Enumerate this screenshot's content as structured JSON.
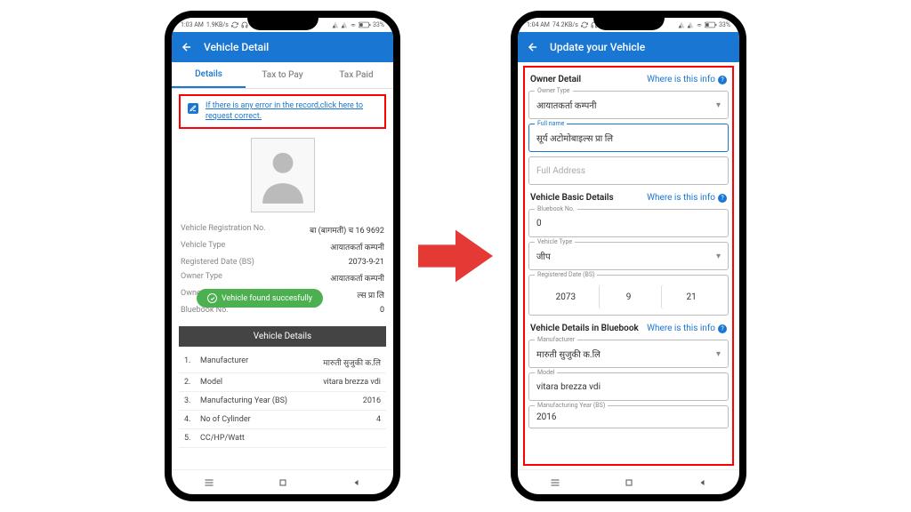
{
  "left": {
    "status": {
      "time": "1:03 AM",
      "speed": "1.9KB/s",
      "battery": "33%"
    },
    "title": "Vehicle Detail",
    "tabs": [
      "Details",
      "Tax to Pay",
      "Tax Paid"
    ],
    "error_link": "If there is any error in the record,click here to request correct.",
    "info": {
      "reg_no_label": "Vehicle Registration No.",
      "reg_no": "बा (बागमती) च 16 9692",
      "veh_type_label": "Vehicle Type",
      "veh_type": "आयातकर्ता कम्पनी",
      "reg_date_label": "Registered Date (BS)",
      "reg_date": "2073-9-21",
      "owner_type_label": "Owner Type",
      "owner_type": "आयातकर्ता कम्पनी",
      "owner_label": "Owner's",
      "owner_val": "ल्स प्रा लि",
      "bluebook_label": "Bluebook No.",
      "bluebook": "0"
    },
    "success": "Vehicle found succesfully",
    "details_header": "Vehicle Details",
    "details": [
      {
        "n": "1.",
        "l": "Manufacturer",
        "v": "मारुती सुजुकी क.लि"
      },
      {
        "n": "2.",
        "l": "Model",
        "v": "vitara brezza vdi"
      },
      {
        "n": "3.",
        "l": "Manufacturing Year (BS)",
        "v": "2016"
      },
      {
        "n": "4.",
        "l": "No of Cylinder",
        "v": "4"
      },
      {
        "n": "5.",
        "l": "CC/HP/Watt",
        "v": ""
      }
    ]
  },
  "right": {
    "status": {
      "time": "1:04 AM",
      "speed": "74.2KB/s",
      "battery": "33%"
    },
    "title": "Update your Vehicle",
    "info_link": "Where is this info",
    "sections": {
      "owner": "Owner Detail",
      "basic": "Vehicle Basic Details",
      "bluebook": "Vehicle Details in Bluebook"
    },
    "fields": {
      "owner_type_lbl": "Owner Type",
      "owner_type": "आयातकर्ता कम्पनी",
      "full_name_lbl": "Full name",
      "full_name": "सूर्य अटोमोबाइल्स प्रा लि",
      "full_address_ph": "Full Address",
      "bluebook_lbl": "Bluebook No.",
      "bluebook": "0",
      "veh_type_lbl": "Vehicle Type",
      "veh_type": "जीप",
      "reg_date_lbl": "Registered Date (BS)",
      "reg_y": "2073",
      "reg_m": "9",
      "reg_d": "21",
      "manuf_lbl": "Manufacturer",
      "manuf": "मारुती सुजुकी क.लि",
      "model_lbl": "Model",
      "model": "vitara brezza vdi",
      "year_lbl": "Manufacturing Year (BS)",
      "year": "2016"
    }
  }
}
